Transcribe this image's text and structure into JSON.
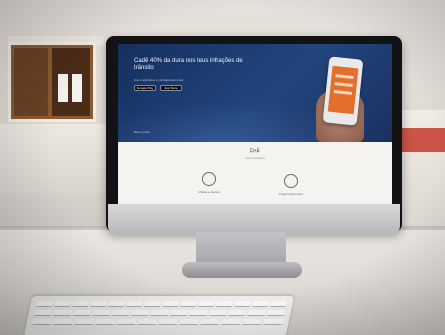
{
  "scene": {
    "description_kind": "photo"
  },
  "screen": {
    "hero": {
      "headline": "Cadê 40% da dura nos teus infrações de trânsito",
      "subline": "Use o aplicativo e consiga descontos",
      "store_buttons": [
        "Google Play",
        "App Store"
      ],
      "footer": "Baixe grátis"
    },
    "content": {
      "logo": "D+E",
      "tagline": "como funciona",
      "features": [
        {
          "label": "Multas e Alertas",
          "icon": "clock-icon"
        },
        {
          "label": "Pague Descontos",
          "icon": "compass-icon"
        }
      ]
    }
  },
  "colors": {
    "hero_bg": "#1a3160",
    "phone_screen": "#e2702c",
    "accent_red": "#c73a2c"
  }
}
